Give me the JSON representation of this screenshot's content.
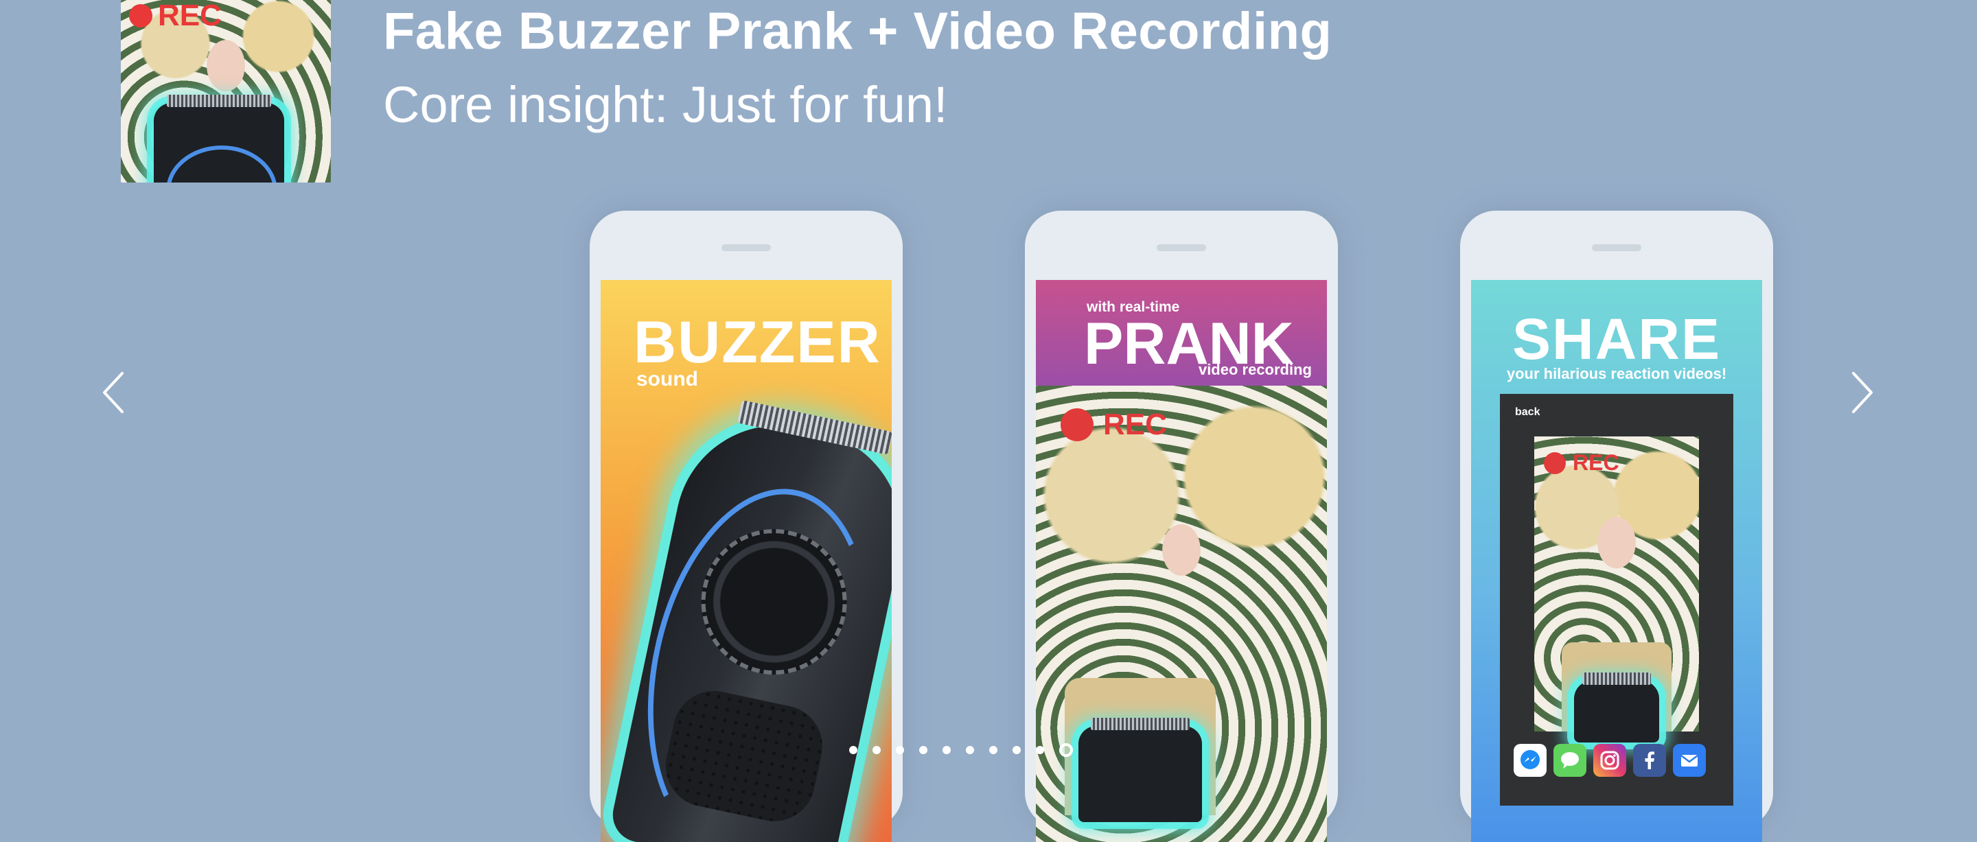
{
  "header": {
    "title": "Fake Buzzer Prank + Video Recording",
    "subtitle": "Core insight: Just for fun!",
    "thumbnail_rec": "REC"
  },
  "slides": [
    {
      "heading": "BUZZER",
      "subheading": "sound"
    },
    {
      "kicker": "with real-time",
      "heading": "PRANK",
      "subheading": "video recording",
      "rec": "REC"
    },
    {
      "heading": "SHARE",
      "subheading": "your hilarious reaction videos!",
      "back_label": "back",
      "rec": "REC",
      "share_targets": [
        "messenger-icon",
        "messages-icon",
        "instagram-icon",
        "facebook-icon",
        "mail-icon"
      ]
    }
  ],
  "carousel": {
    "prev_icon": "chevron-left-icon",
    "next_icon": "chevron-right-icon",
    "dot_count": 10,
    "active_index": 9
  },
  "colors": {
    "background": "#96adc8",
    "rec_red": "#e83838",
    "glow_cyan": "#5cf0e8"
  }
}
